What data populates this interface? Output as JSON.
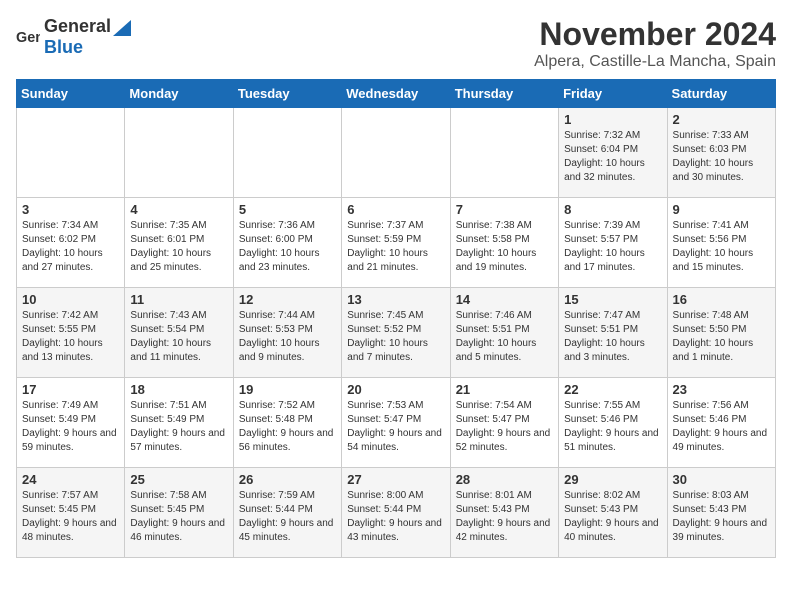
{
  "header": {
    "logo": {
      "general": "General",
      "blue": "Blue"
    },
    "month": "November 2024",
    "location": "Alpera, Castille-La Mancha, Spain"
  },
  "weekdays": [
    "Sunday",
    "Monday",
    "Tuesday",
    "Wednesday",
    "Thursday",
    "Friday",
    "Saturday"
  ],
  "weeks": [
    [
      {
        "day": "",
        "info": ""
      },
      {
        "day": "",
        "info": ""
      },
      {
        "day": "",
        "info": ""
      },
      {
        "day": "",
        "info": ""
      },
      {
        "day": "",
        "info": ""
      },
      {
        "day": "1",
        "info": "Sunrise: 7:32 AM\nSunset: 6:04 PM\nDaylight: 10 hours and 32 minutes."
      },
      {
        "day": "2",
        "info": "Sunrise: 7:33 AM\nSunset: 6:03 PM\nDaylight: 10 hours and 30 minutes."
      }
    ],
    [
      {
        "day": "3",
        "info": "Sunrise: 7:34 AM\nSunset: 6:02 PM\nDaylight: 10 hours and 27 minutes."
      },
      {
        "day": "4",
        "info": "Sunrise: 7:35 AM\nSunset: 6:01 PM\nDaylight: 10 hours and 25 minutes."
      },
      {
        "day": "5",
        "info": "Sunrise: 7:36 AM\nSunset: 6:00 PM\nDaylight: 10 hours and 23 minutes."
      },
      {
        "day": "6",
        "info": "Sunrise: 7:37 AM\nSunset: 5:59 PM\nDaylight: 10 hours and 21 minutes."
      },
      {
        "day": "7",
        "info": "Sunrise: 7:38 AM\nSunset: 5:58 PM\nDaylight: 10 hours and 19 minutes."
      },
      {
        "day": "8",
        "info": "Sunrise: 7:39 AM\nSunset: 5:57 PM\nDaylight: 10 hours and 17 minutes."
      },
      {
        "day": "9",
        "info": "Sunrise: 7:41 AM\nSunset: 5:56 PM\nDaylight: 10 hours and 15 minutes."
      }
    ],
    [
      {
        "day": "10",
        "info": "Sunrise: 7:42 AM\nSunset: 5:55 PM\nDaylight: 10 hours and 13 minutes."
      },
      {
        "day": "11",
        "info": "Sunrise: 7:43 AM\nSunset: 5:54 PM\nDaylight: 10 hours and 11 minutes."
      },
      {
        "day": "12",
        "info": "Sunrise: 7:44 AM\nSunset: 5:53 PM\nDaylight: 10 hours and 9 minutes."
      },
      {
        "day": "13",
        "info": "Sunrise: 7:45 AM\nSunset: 5:52 PM\nDaylight: 10 hours and 7 minutes."
      },
      {
        "day": "14",
        "info": "Sunrise: 7:46 AM\nSunset: 5:51 PM\nDaylight: 10 hours and 5 minutes."
      },
      {
        "day": "15",
        "info": "Sunrise: 7:47 AM\nSunset: 5:51 PM\nDaylight: 10 hours and 3 minutes."
      },
      {
        "day": "16",
        "info": "Sunrise: 7:48 AM\nSunset: 5:50 PM\nDaylight: 10 hours and 1 minute."
      }
    ],
    [
      {
        "day": "17",
        "info": "Sunrise: 7:49 AM\nSunset: 5:49 PM\nDaylight: 9 hours and 59 minutes."
      },
      {
        "day": "18",
        "info": "Sunrise: 7:51 AM\nSunset: 5:49 PM\nDaylight: 9 hours and 57 minutes."
      },
      {
        "day": "19",
        "info": "Sunrise: 7:52 AM\nSunset: 5:48 PM\nDaylight: 9 hours and 56 minutes."
      },
      {
        "day": "20",
        "info": "Sunrise: 7:53 AM\nSunset: 5:47 PM\nDaylight: 9 hours and 54 minutes."
      },
      {
        "day": "21",
        "info": "Sunrise: 7:54 AM\nSunset: 5:47 PM\nDaylight: 9 hours and 52 minutes."
      },
      {
        "day": "22",
        "info": "Sunrise: 7:55 AM\nSunset: 5:46 PM\nDaylight: 9 hours and 51 minutes."
      },
      {
        "day": "23",
        "info": "Sunrise: 7:56 AM\nSunset: 5:46 PM\nDaylight: 9 hours and 49 minutes."
      }
    ],
    [
      {
        "day": "24",
        "info": "Sunrise: 7:57 AM\nSunset: 5:45 PM\nDaylight: 9 hours and 48 minutes."
      },
      {
        "day": "25",
        "info": "Sunrise: 7:58 AM\nSunset: 5:45 PM\nDaylight: 9 hours and 46 minutes."
      },
      {
        "day": "26",
        "info": "Sunrise: 7:59 AM\nSunset: 5:44 PM\nDaylight: 9 hours and 45 minutes."
      },
      {
        "day": "27",
        "info": "Sunrise: 8:00 AM\nSunset: 5:44 PM\nDaylight: 9 hours and 43 minutes."
      },
      {
        "day": "28",
        "info": "Sunrise: 8:01 AM\nSunset: 5:43 PM\nDaylight: 9 hours and 42 minutes."
      },
      {
        "day": "29",
        "info": "Sunrise: 8:02 AM\nSunset: 5:43 PM\nDaylight: 9 hours and 40 minutes."
      },
      {
        "day": "30",
        "info": "Sunrise: 8:03 AM\nSunset: 5:43 PM\nDaylight: 9 hours and 39 minutes."
      }
    ]
  ]
}
